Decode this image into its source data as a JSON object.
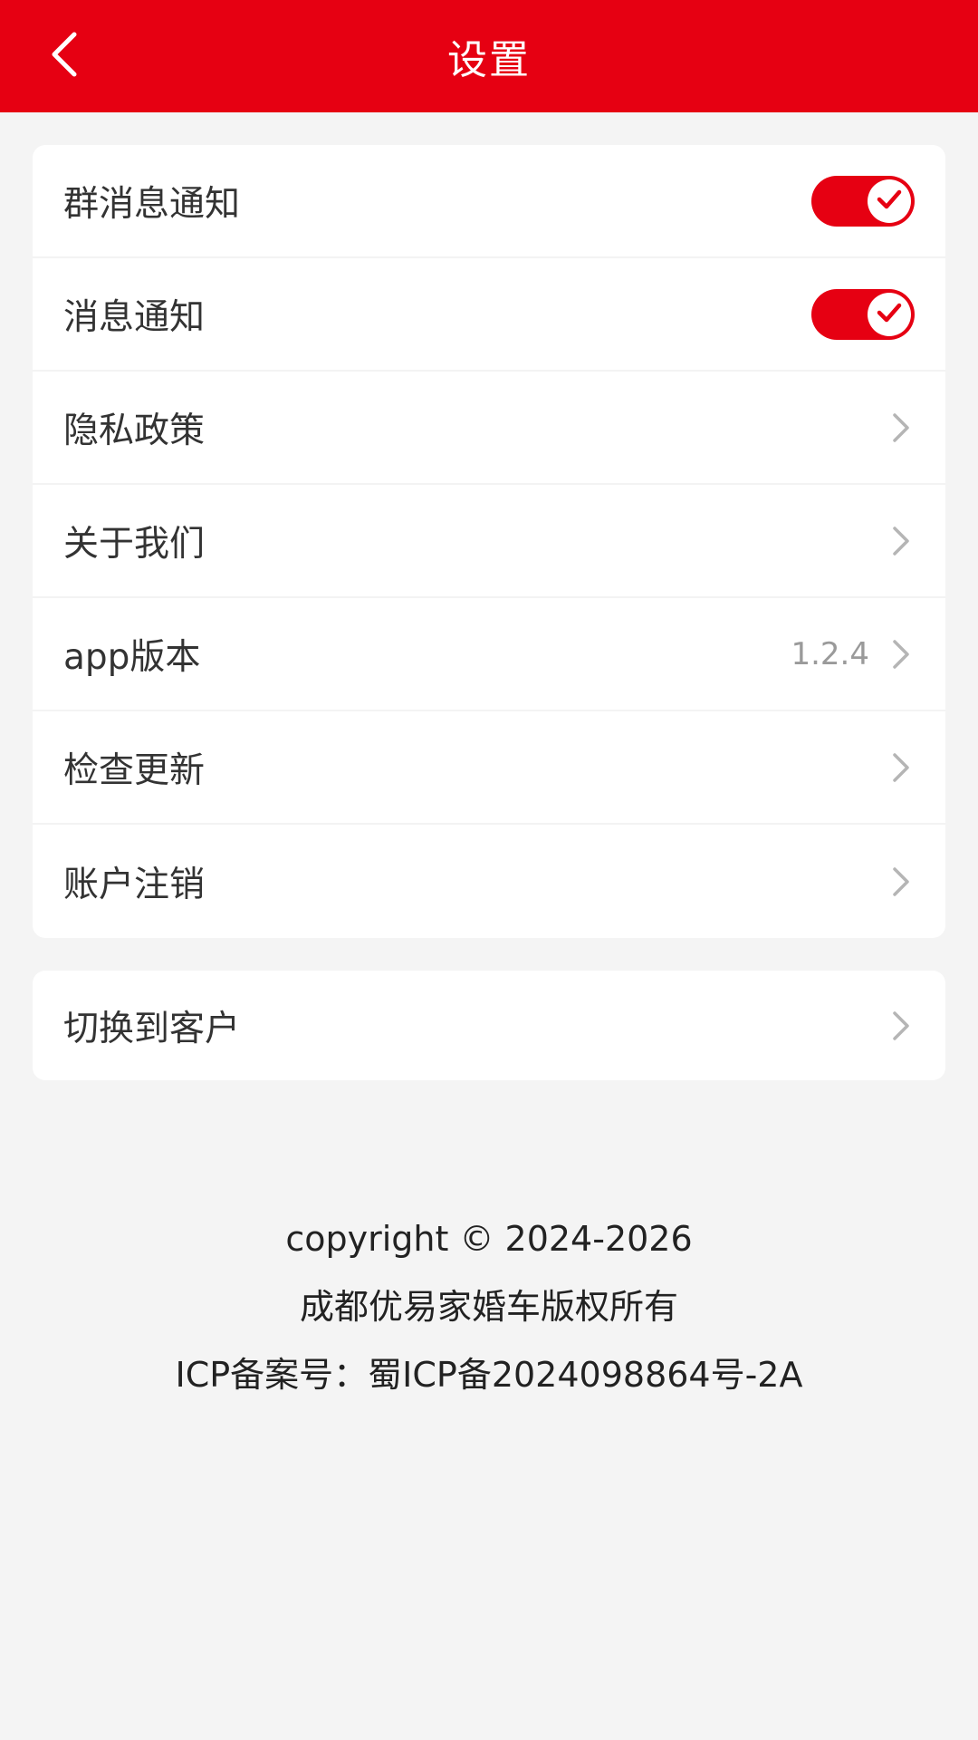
{
  "header": {
    "title": "设置",
    "accent_color": "#e60012",
    "back_icon": "chevron-left-icon"
  },
  "settings": {
    "group_notification": {
      "label": "群消息通知",
      "enabled": true
    },
    "message_notification": {
      "label": "消息通知",
      "enabled": true
    },
    "privacy_policy": {
      "label": "隐私政策"
    },
    "about_us": {
      "label": "关于我们"
    },
    "app_version": {
      "label": "app版本",
      "value": "1.2.4"
    },
    "check_update": {
      "label": "检查更新"
    },
    "account_cancel": {
      "label": "账户注销"
    }
  },
  "switch_section": {
    "switch_to_customer": {
      "label": "切换到客户"
    }
  },
  "footer": {
    "copyright": "copyright © 2024-2026",
    "owner": "成都优易家婚车版权所有",
    "icp": "ICP备案号：蜀ICP备2024098864号-2A"
  }
}
